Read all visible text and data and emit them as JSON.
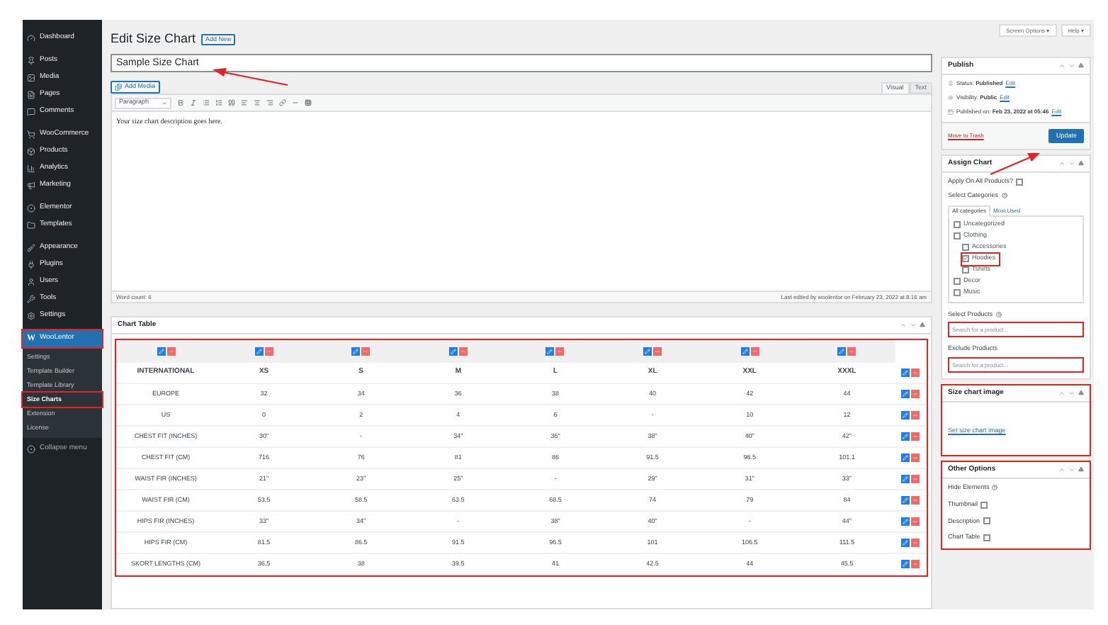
{
  "sidebar": {
    "menu": [
      {
        "label": "Dashboard",
        "selected": false,
        "highlighted": false
      },
      {
        "label": "Posts",
        "selected": false,
        "highlighted": false
      },
      {
        "label": "Media",
        "selected": false,
        "highlighted": false
      },
      {
        "label": "Pages",
        "selected": false,
        "highlighted": false
      },
      {
        "label": "Comments",
        "selected": false,
        "highlighted": false
      },
      {
        "label": "WooCommerce",
        "selected": false,
        "highlighted": false
      },
      {
        "label": "Products",
        "selected": false,
        "highlighted": false
      },
      {
        "label": "Analytics",
        "selected": false,
        "highlighted": false
      },
      {
        "label": "Marketing",
        "selected": false,
        "highlighted": false
      },
      {
        "label": "Elementor",
        "selected": false,
        "highlighted": false
      },
      {
        "label": "Templates",
        "selected": false,
        "highlighted": false
      },
      {
        "label": "Appearance",
        "selected": false,
        "highlighted": false
      },
      {
        "label": "Plugins",
        "selected": false,
        "highlighted": false
      },
      {
        "label": "Users",
        "selected": false,
        "highlighted": false
      },
      {
        "label": "Tools",
        "selected": false,
        "highlighted": false
      },
      {
        "label": "Settings",
        "selected": false,
        "highlighted": false
      },
      {
        "label": "WooLentor",
        "badge": "W",
        "selected": true,
        "highlighted": true,
        "children": [
          {
            "label": "Settings",
            "selected": false,
            "highlighted": false
          },
          {
            "label": "Template Builder",
            "selected": false,
            "highlighted": false
          },
          {
            "label": "Template Library",
            "selected": false,
            "highlighted": false
          },
          {
            "label": "Size Charts",
            "selected": true,
            "highlighted": true
          },
          {
            "label": "Extension",
            "selected": false,
            "highlighted": false
          },
          {
            "label": "License",
            "selected": false,
            "highlighted": false
          }
        ]
      }
    ],
    "collapse": "Collapse menu"
  },
  "page": {
    "title": "Edit Size Chart",
    "add_new": "Add New",
    "title_value": "Sample Size Chart"
  },
  "editor": {
    "add_media": "Add Media",
    "tabs": [
      {
        "label": "Visual",
        "selected": true
      },
      {
        "label": "Text",
        "selected": false
      }
    ],
    "format": "Paragraph",
    "content": "Your size chart description goes here.",
    "word_count": "Word count: 6",
    "last_edited": "Last edited by woolentor on February 23, 2022 at 8:16 am"
  },
  "chart_table": {
    "title": "Chart Table",
    "highlighted": true,
    "header": [
      "INTERNATIONAL",
      "XS",
      "S",
      "M",
      "L",
      "XL",
      "XXL",
      "XXXL"
    ],
    "rows": [
      [
        "EUROPE",
        "32",
        "34",
        "36",
        "38",
        "40",
        "42",
        "44"
      ],
      [
        "US",
        "0",
        "2",
        "4",
        "6",
        "-",
        "10",
        "12"
      ],
      [
        "CHEST FIT (INCHES)",
        "30\"",
        "-",
        "34\"",
        "36\"",
        "38\"",
        "40\"",
        "42\""
      ],
      [
        "CHEST FIT (CM)",
        "716",
        "76",
        "81",
        "86",
        "91.5",
        "96.5",
        "101.1"
      ],
      [
        "WAIST FIR (INCHES)",
        "21\"",
        "23\"",
        "25\"",
        "-",
        "29\"",
        "31\"",
        "33\""
      ],
      [
        "WAIST FIR (CM)",
        "53.5",
        "58.5",
        "63.5",
        "68.5",
        "74",
        "79",
        "84"
      ],
      [
        "HIPS FIR (INCHES)",
        "33\"",
        "34\"",
        "-",
        "38\"",
        "40\"",
        "-",
        "44\""
      ],
      [
        "HIPS FIR (CM)",
        "81.5",
        "86.5",
        "91.5",
        "96.5",
        "101",
        "106.5",
        "111.5"
      ],
      [
        "SKORT LENGTHS (CM)",
        "36.5",
        "38",
        "39.5",
        "41",
        "42.5",
        "44",
        "45.5"
      ]
    ]
  },
  "top_buttons": [
    "Screen Options ▾",
    "Help ▾"
  ],
  "publish": {
    "title": "Publish",
    "status": "Status: **Published**",
    "visibility": "Visibility: **Public**",
    "published_on": "Published on: **Feb 23, 2022 at 05:46**",
    "edit_links": [
      "Edit",
      "Edit",
      "Edit"
    ],
    "trash": "Move to Trash",
    "update": "Update"
  },
  "assign_chart": {
    "title": "Assign Chart",
    "apply_all": {
      "label": "Apply On All Products?",
      "checked": false
    },
    "select_categories": "Select Categories",
    "tabs": [
      {
        "label": "All categories",
        "selected": true
      },
      {
        "label": "Most Used",
        "selected": false
      }
    ],
    "categories": [
      {
        "label": "Uncategorized",
        "checked": false,
        "highlighted": false
      },
      {
        "label": "Clothing",
        "checked": false,
        "highlighted": false,
        "children": [
          {
            "label": "Accessories",
            "checked": false,
            "highlighted": false
          },
          {
            "label": "Hoodies",
            "checked": true,
            "highlighted": true
          },
          {
            "label": "Tshirts",
            "checked": false,
            "highlighted": false
          }
        ]
      },
      {
        "label": "Decor",
        "checked": false,
        "highlighted": false
      },
      {
        "label": "Music",
        "checked": false,
        "highlighted": false
      }
    ],
    "select_products": {
      "label": "Select Products",
      "placeholder": "Search for a product...",
      "highlighted": true
    },
    "exclude_products": {
      "label": "Exclude Products",
      "placeholder": "Search for a product...",
      "highlighted": true
    }
  },
  "size_chart_image": {
    "title": "Size chart image",
    "link": "Set size chart image",
    "highlighted": true
  },
  "other_options": {
    "title": "Other Options",
    "hide_elements": "Hide Elements",
    "highlighted": true,
    "options": [
      {
        "label": "Thumbnail",
        "checked": false
      },
      {
        "label": "Description",
        "checked": false
      },
      {
        "label": "Chart Table",
        "checked": false
      }
    ]
  }
}
